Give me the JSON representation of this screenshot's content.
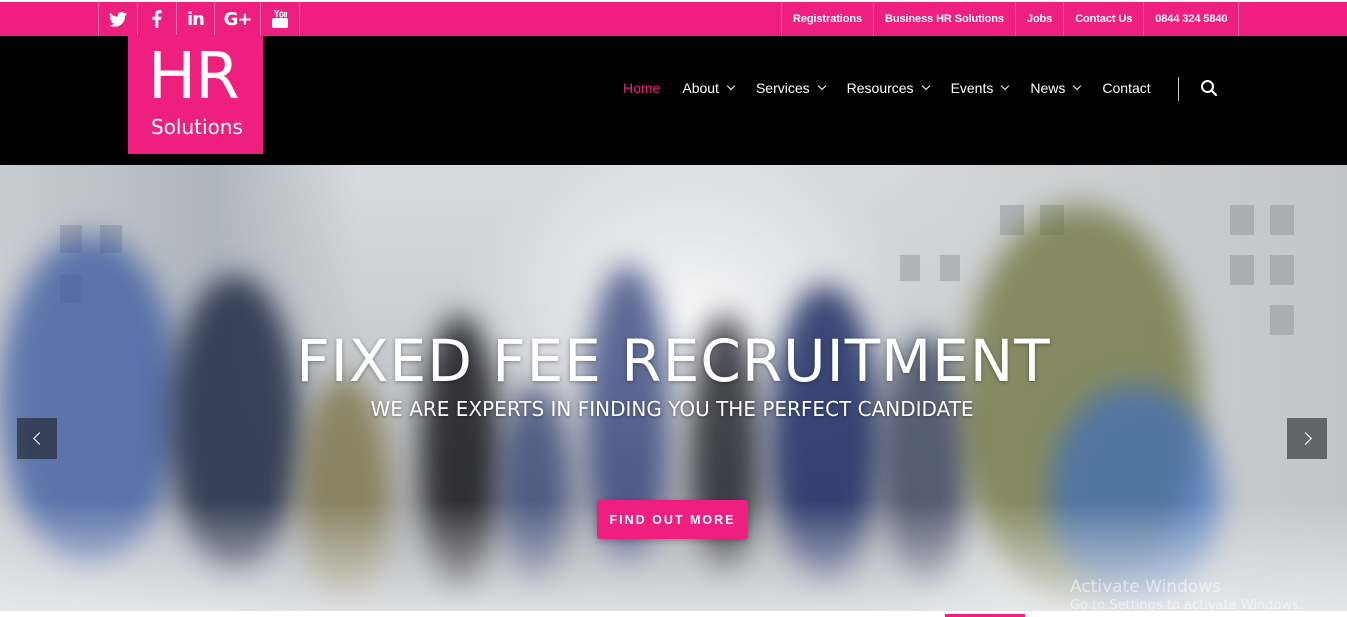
{
  "social": {
    "icons": [
      "twitter-icon",
      "facebook-icon",
      "linkedin-icon",
      "google-plus-icon",
      "youtube-icon"
    ],
    "linkedin_glyph": "in",
    "google_glyph": "G+"
  },
  "toplinks": [
    "Registrations",
    "Business HR Solutions",
    "Jobs",
    "Contact Us",
    "0844 324 5840"
  ],
  "logo": {
    "line1": "HR",
    "line2": "Solutions"
  },
  "nav": {
    "items": [
      {
        "label": "Home",
        "active": true,
        "dropdown": false
      },
      {
        "label": "About",
        "dropdown": true
      },
      {
        "label": "Services",
        "dropdown": true
      },
      {
        "label": "Resources",
        "dropdown": true
      },
      {
        "label": "Events",
        "dropdown": true
      },
      {
        "label": "News",
        "dropdown": true
      },
      {
        "label": "Contact",
        "dropdown": false
      }
    ]
  },
  "hero": {
    "title": "FIXED FEE RECRUITMENT",
    "subtitle": "WE ARE EXPERTS IN FINDING YOU THE PERFECT CANDIDATE",
    "cta_label": "FIND OUT MORE"
  },
  "watermark": {
    "line1": "Activate Windows",
    "line2": "Go to Settings to activate Windows."
  },
  "colors": {
    "brand": "#ef1f7f",
    "header_bg": "#000000"
  }
}
